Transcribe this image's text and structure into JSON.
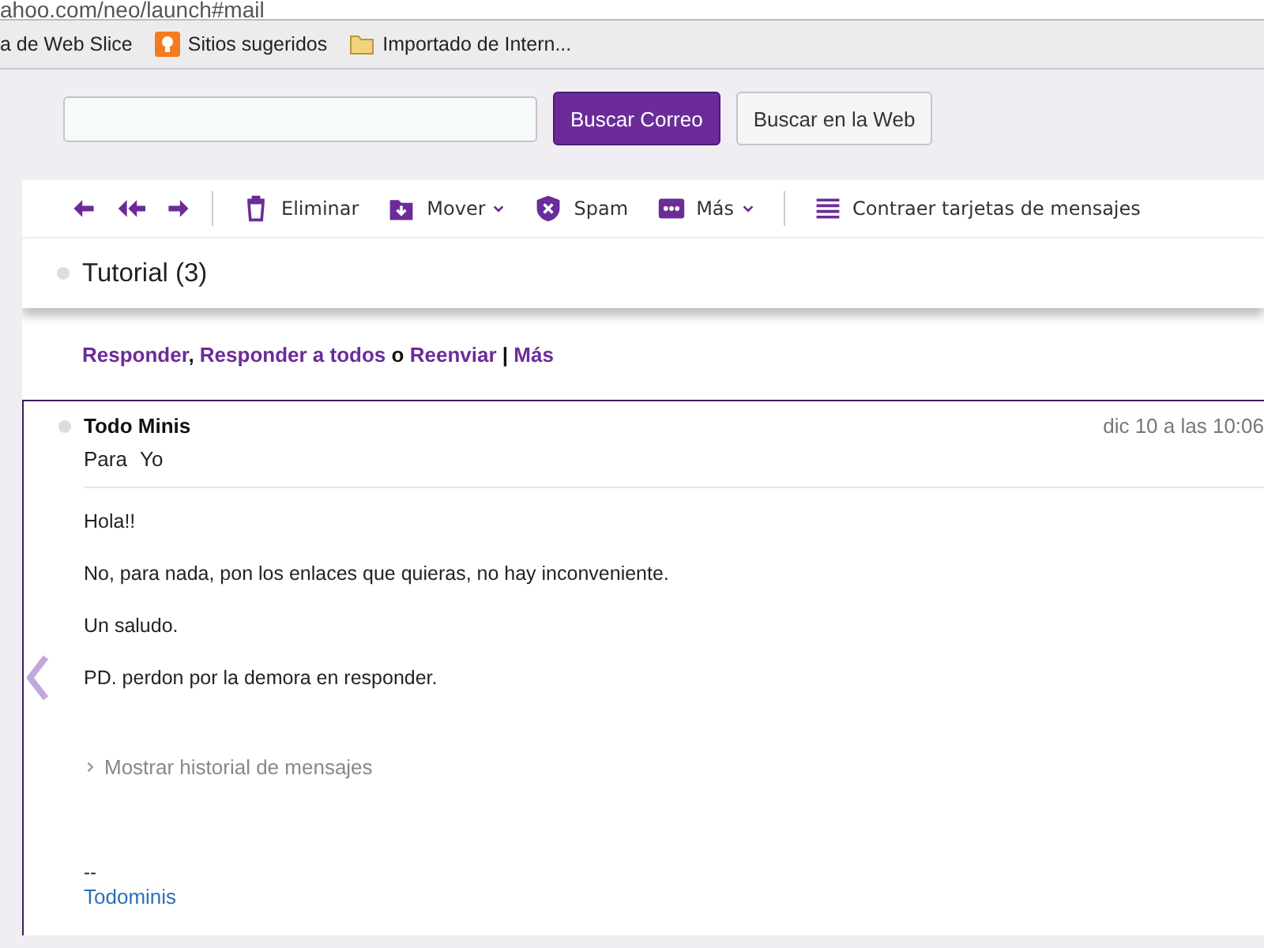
{
  "address_bar": {
    "url": "ahoo.com/neo/launch#mail"
  },
  "bookmarks": [
    {
      "label": "a de Web Slice",
      "kind": "plain"
    },
    {
      "label": "Sitios sugeridos",
      "kind": "bulb"
    },
    {
      "label": "Importado de Intern...",
      "kind": "folder"
    }
  ],
  "search": {
    "buttons": [
      {
        "label": "Buscar Correo",
        "primary": true
      },
      {
        "label": "Buscar en la Web",
        "primary": false
      }
    ]
  },
  "toolbar": [
    {
      "kind": "reply"
    },
    {
      "kind": "reply-all"
    },
    {
      "kind": "forward"
    },
    {
      "kind": "divider"
    },
    {
      "kind": "trash",
      "label": "Eliminar"
    },
    {
      "kind": "move",
      "label": "Mover",
      "dropdown": true
    },
    {
      "kind": "shield",
      "label": "Spam"
    },
    {
      "kind": "dots",
      "label": "Más",
      "dropdown": true
    },
    {
      "kind": "divider"
    },
    {
      "kind": "lines",
      "label": "Contraer tarjetas de mensajes"
    }
  ],
  "conversation": {
    "title": "Tutorial (3)"
  },
  "reply_links": [
    {
      "text": "Responder",
      "sep": ", "
    },
    {
      "text": "Responder a todos",
      "sep": " o "
    },
    {
      "text": "Reenviar",
      "sep": " | "
    },
    {
      "text": "Más"
    }
  ],
  "message": {
    "sender": "Todo Minis",
    "date": "dic 10 a las 10:06",
    "to_label": "Para",
    "to": "Yo",
    "body": [
      "Hola!!",
      "No, para nada, pon los enlaces que quieras, no hay inconveniente.",
      "Un saludo.",
      "PD. perdon por la demora en responder."
    ],
    "history": "Mostrar historial de mensajes",
    "signature_dash": "--",
    "signature_link": "Todominis"
  }
}
